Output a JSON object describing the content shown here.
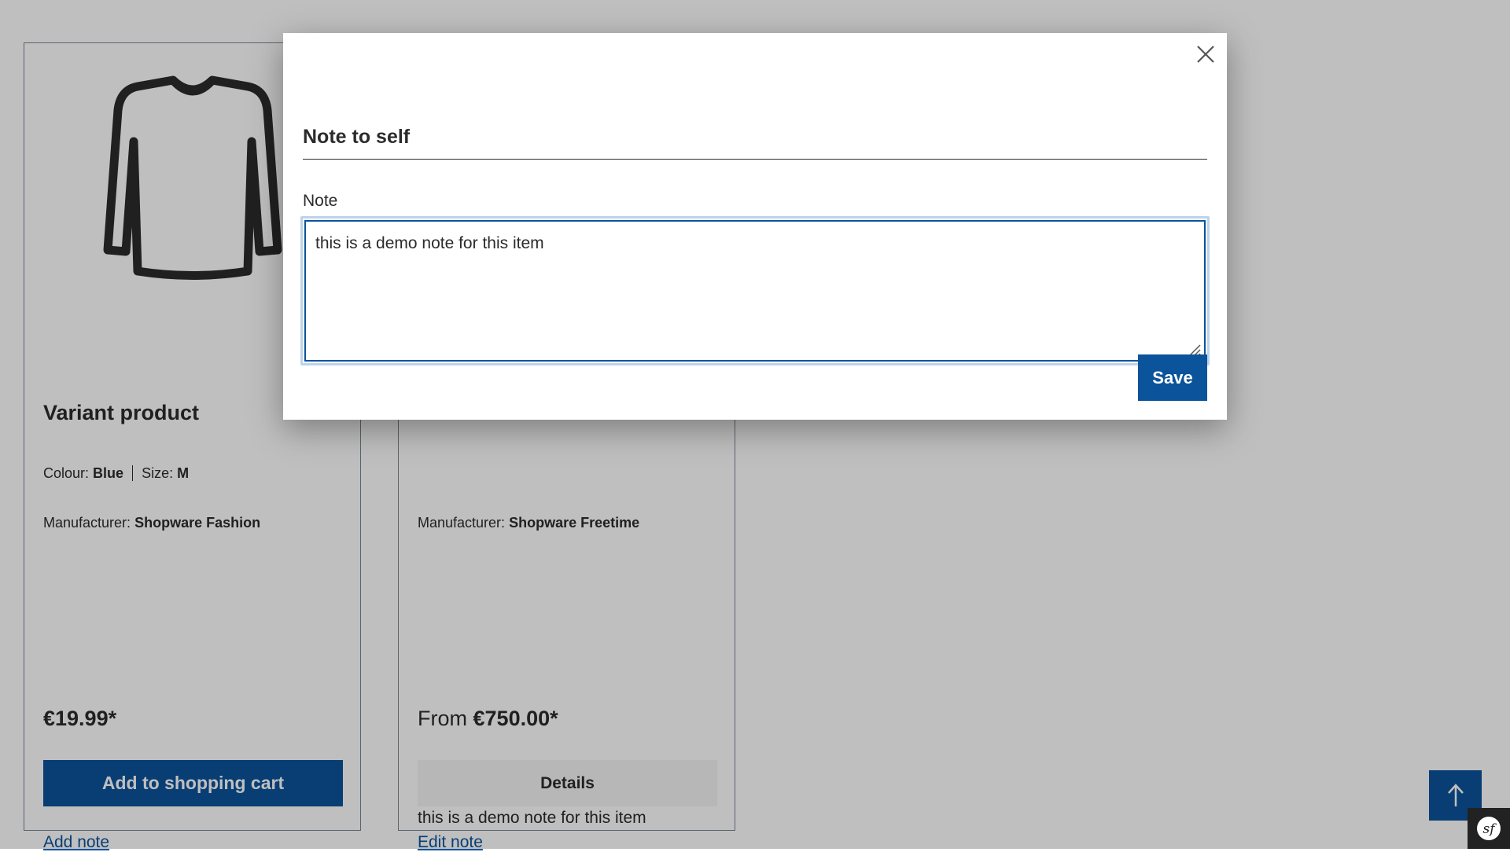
{
  "products": [
    {
      "title": "Variant product",
      "variant_colour_label": "Colour:",
      "variant_colour_value": "Blue",
      "variant_size_label": "Size:",
      "variant_size_value": "M",
      "manufacturer_label": "Manufacturer:",
      "manufacturer_value": "Shopware Fashion",
      "price": "€19.99*",
      "action_label": "Add to shopping cart",
      "note_link": "Add note"
    },
    {
      "manufacturer_label": "Manufacturer:",
      "manufacturer_value": "Shopware Freetime",
      "price_prefix": "From",
      "price": "€750.00*",
      "action_label": "Details",
      "note_text": "this is a demo note for this item",
      "note_link": "Edit note"
    }
  ],
  "modal": {
    "title": "Note to self",
    "field_label": "Note",
    "note_value": "this is a demo note for this item",
    "save_label": "Save",
    "close_icon": "close-icon"
  },
  "icons": {
    "product_image": "shirt-icon",
    "scroll_top": "arrow-up-icon",
    "debug_toolbar": "symfony-icon"
  },
  "colors": {
    "primary": "#0b539b",
    "text": "#2b2b2b",
    "overlay": "rgba(0,0,0,0.25)"
  }
}
